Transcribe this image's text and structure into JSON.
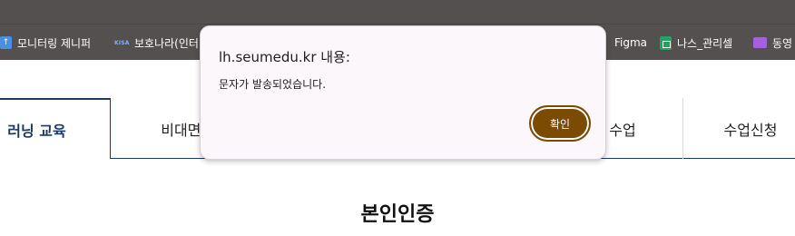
{
  "bookmarks": [
    {
      "label": "모니터링 제니퍼",
      "icon": "bookmark-favicon-icon"
    },
    {
      "label": "보호나라(인터",
      "icon": "kisa-favicon-icon",
      "icon_text": "KISA"
    },
    {
      "label": "Figma",
      "icon": "figma-favicon-icon"
    },
    {
      "label": "나스_관리셀",
      "icon": "sheets-favicon-icon"
    },
    {
      "label": "동영",
      "icon": "folder-icon"
    }
  ],
  "nav": {
    "active_label": "러닝 교육",
    "item2_label": "비대면/",
    "item3_label": "수업",
    "item4_label": "수업신청"
  },
  "page": {
    "title": "본인인증"
  },
  "dialog": {
    "title": "lh.seumedu.kr 내용:",
    "message": "문자가 발송되었습니다.",
    "ok_label": "확인"
  },
  "colors": {
    "browser_chrome": "#54504f",
    "nav_accent": "#1c3a66",
    "dialog_button": "#7a4b00",
    "dialog_bg": "#fcf7fb"
  }
}
